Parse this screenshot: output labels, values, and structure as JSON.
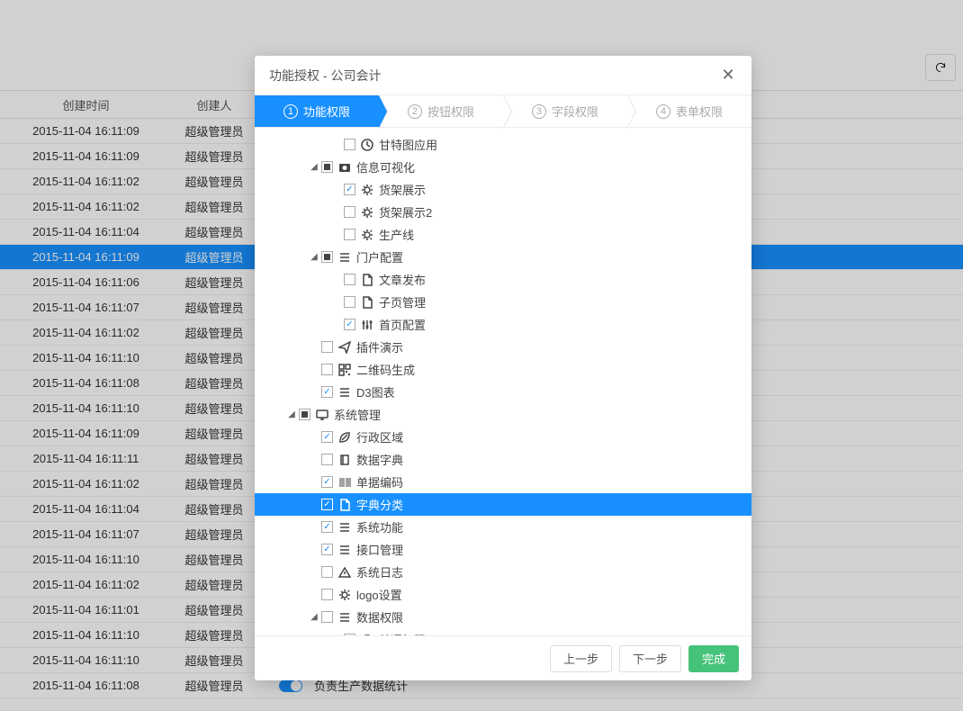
{
  "table": {
    "headers": {
      "time": "创建时间",
      "user": "创建人"
    },
    "rows": [
      {
        "time": "2015-11-04 16:11:09",
        "user": "超级管理员",
        "toggle": true,
        "desc": "",
        "selected": false
      },
      {
        "time": "2015-11-04 16:11:09",
        "user": "超级管理员",
        "toggle": true,
        "desc": "",
        "selected": false
      },
      {
        "time": "2015-11-04 16:11:02",
        "user": "超级管理员",
        "toggle": true,
        "desc": "",
        "selected": false
      },
      {
        "time": "2015-11-04 16:11:02",
        "user": "超级管理员",
        "toggle": true,
        "desc": "",
        "selected": false
      },
      {
        "time": "2015-11-04 16:11:04",
        "user": "超级管理员",
        "toggle": true,
        "desc": "",
        "selected": false
      },
      {
        "time": "2015-11-04 16:11:09",
        "user": "超级管理员",
        "toggle": true,
        "desc": "",
        "selected": true
      },
      {
        "time": "2015-11-04 16:11:06",
        "user": "超级管理员",
        "toggle": true,
        "desc": "",
        "selected": false
      },
      {
        "time": "2015-11-04 16:11:07",
        "user": "超级管理员",
        "toggle": true,
        "desc": "",
        "selected": false
      },
      {
        "time": "2015-11-04 16:11:02",
        "user": "超级管理员",
        "toggle": true,
        "desc": "",
        "selected": false
      },
      {
        "time": "2015-11-04 16:11:10",
        "user": "超级管理员",
        "toggle": true,
        "desc": "",
        "selected": false
      },
      {
        "time": "2015-11-04 16:11:08",
        "user": "超级管理员",
        "toggle": true,
        "desc": "",
        "selected": false
      },
      {
        "time": "2015-11-04 16:11:10",
        "user": "超级管理员",
        "toggle": true,
        "desc": "",
        "selected": false
      },
      {
        "time": "2015-11-04 16:11:09",
        "user": "超级管理员",
        "toggle": true,
        "desc": "",
        "selected": false
      },
      {
        "time": "2015-11-04 16:11:11",
        "user": "超级管理员",
        "toggle": true,
        "desc": "",
        "selected": false
      },
      {
        "time": "2015-11-04 16:11:02",
        "user": "超级管理员",
        "toggle": true,
        "desc": "",
        "selected": false
      },
      {
        "time": "2015-11-04 16:11:04",
        "user": "超级管理员",
        "toggle": true,
        "desc": "",
        "selected": false
      },
      {
        "time": "2015-11-04 16:11:07",
        "user": "超级管理员",
        "toggle": true,
        "desc": "",
        "selected": false
      },
      {
        "time": "2015-11-04 16:11:10",
        "user": "超级管理员",
        "toggle": true,
        "desc": "",
        "selected": false
      },
      {
        "time": "2015-11-04 16:11:02",
        "user": "超级管理员",
        "toggle": true,
        "desc": "",
        "selected": false
      },
      {
        "time": "2015-11-04 16:11:01",
        "user": "超级管理员",
        "toggle": true,
        "desc": "",
        "selected": false
      },
      {
        "time": "2015-11-04 16:11:10",
        "user": "超级管理员",
        "toggle": true,
        "desc": "",
        "selected": false
      },
      {
        "time": "2015-11-04 16:11:10",
        "user": "超级管理员",
        "toggle": true,
        "desc": "",
        "selected": false
      },
      {
        "time": "2015-11-04 16:11:08",
        "user": "超级管理员",
        "toggle": true,
        "desc": "负责生产数据统计",
        "selected": false
      }
    ]
  },
  "modal": {
    "title": "功能授权 - 公司会计",
    "steps": [
      {
        "num": "①",
        "label": "功能权限",
        "active": true
      },
      {
        "num": "②",
        "label": "按钮权限",
        "active": false
      },
      {
        "num": "③",
        "label": "字段权限",
        "active": false
      },
      {
        "num": "④",
        "label": "表单权限",
        "active": false
      }
    ],
    "tree": [
      {
        "level": 3,
        "expand": "",
        "check": "none",
        "icon": "clock",
        "label": "甘特图应用",
        "selected": false
      },
      {
        "level": 2,
        "expand": "open",
        "check": "part",
        "icon": "camera",
        "label": "信息可视化",
        "selected": false
      },
      {
        "level": 3,
        "expand": "",
        "check": "checked",
        "icon": "gear",
        "label": "货架展示",
        "selected": false
      },
      {
        "level": 3,
        "expand": "",
        "check": "none",
        "icon": "gear",
        "label": "货架展示2",
        "selected": false
      },
      {
        "level": 3,
        "expand": "",
        "check": "none",
        "icon": "gear",
        "label": "生产线",
        "selected": false
      },
      {
        "level": 2,
        "expand": "open",
        "check": "part",
        "icon": "list",
        "label": "门户配置",
        "selected": false
      },
      {
        "level": 3,
        "expand": "",
        "check": "none",
        "icon": "doc",
        "label": "文章发布",
        "selected": false
      },
      {
        "level": 3,
        "expand": "",
        "check": "none",
        "icon": "doc",
        "label": "子页管理",
        "selected": false
      },
      {
        "level": 3,
        "expand": "",
        "check": "checked",
        "icon": "sliders",
        "label": "首页配置",
        "selected": false
      },
      {
        "level": 2,
        "expand": "",
        "check": "none",
        "icon": "send",
        "label": "插件演示",
        "selected": false
      },
      {
        "level": 2,
        "expand": "",
        "check": "none",
        "icon": "qr",
        "label": "二维码生成",
        "selected": false
      },
      {
        "level": 2,
        "expand": "",
        "check": "checked",
        "icon": "list",
        "label": "D3图表",
        "selected": false
      },
      {
        "level": 1,
        "expand": "open",
        "check": "part",
        "icon": "monitor",
        "label": "系统管理",
        "selected": false
      },
      {
        "level": 2,
        "expand": "",
        "check": "checked",
        "icon": "leaf",
        "label": "行政区域",
        "selected": false
      },
      {
        "level": 2,
        "expand": "",
        "check": "none",
        "icon": "book",
        "label": "数据字典",
        "selected": false
      },
      {
        "level": 2,
        "expand": "",
        "check": "checked",
        "icon": "barcode",
        "label": "单据编码",
        "selected": false
      },
      {
        "level": 2,
        "expand": "",
        "check": "checked",
        "icon": "doc",
        "label": "字典分类",
        "selected": true
      },
      {
        "level": 2,
        "expand": "",
        "check": "checked",
        "icon": "list",
        "label": "系统功能",
        "selected": false
      },
      {
        "level": 2,
        "expand": "",
        "check": "checked",
        "icon": "list",
        "label": "接口管理",
        "selected": false
      },
      {
        "level": 2,
        "expand": "",
        "check": "none",
        "icon": "warn",
        "label": "系统日志",
        "selected": false
      },
      {
        "level": 2,
        "expand": "",
        "check": "none",
        "icon": "gear",
        "label": "logo设置",
        "selected": false
      },
      {
        "level": 2,
        "expand": "open",
        "check": "none",
        "icon": "list",
        "label": "数据权限",
        "selected": false
      },
      {
        "level": 3,
        "expand": "",
        "check": "none",
        "icon": "briefcase",
        "label": "普通权限",
        "selected": false
      }
    ],
    "footer": {
      "prev": "上一步",
      "next": "下一步",
      "done": "完成"
    }
  }
}
